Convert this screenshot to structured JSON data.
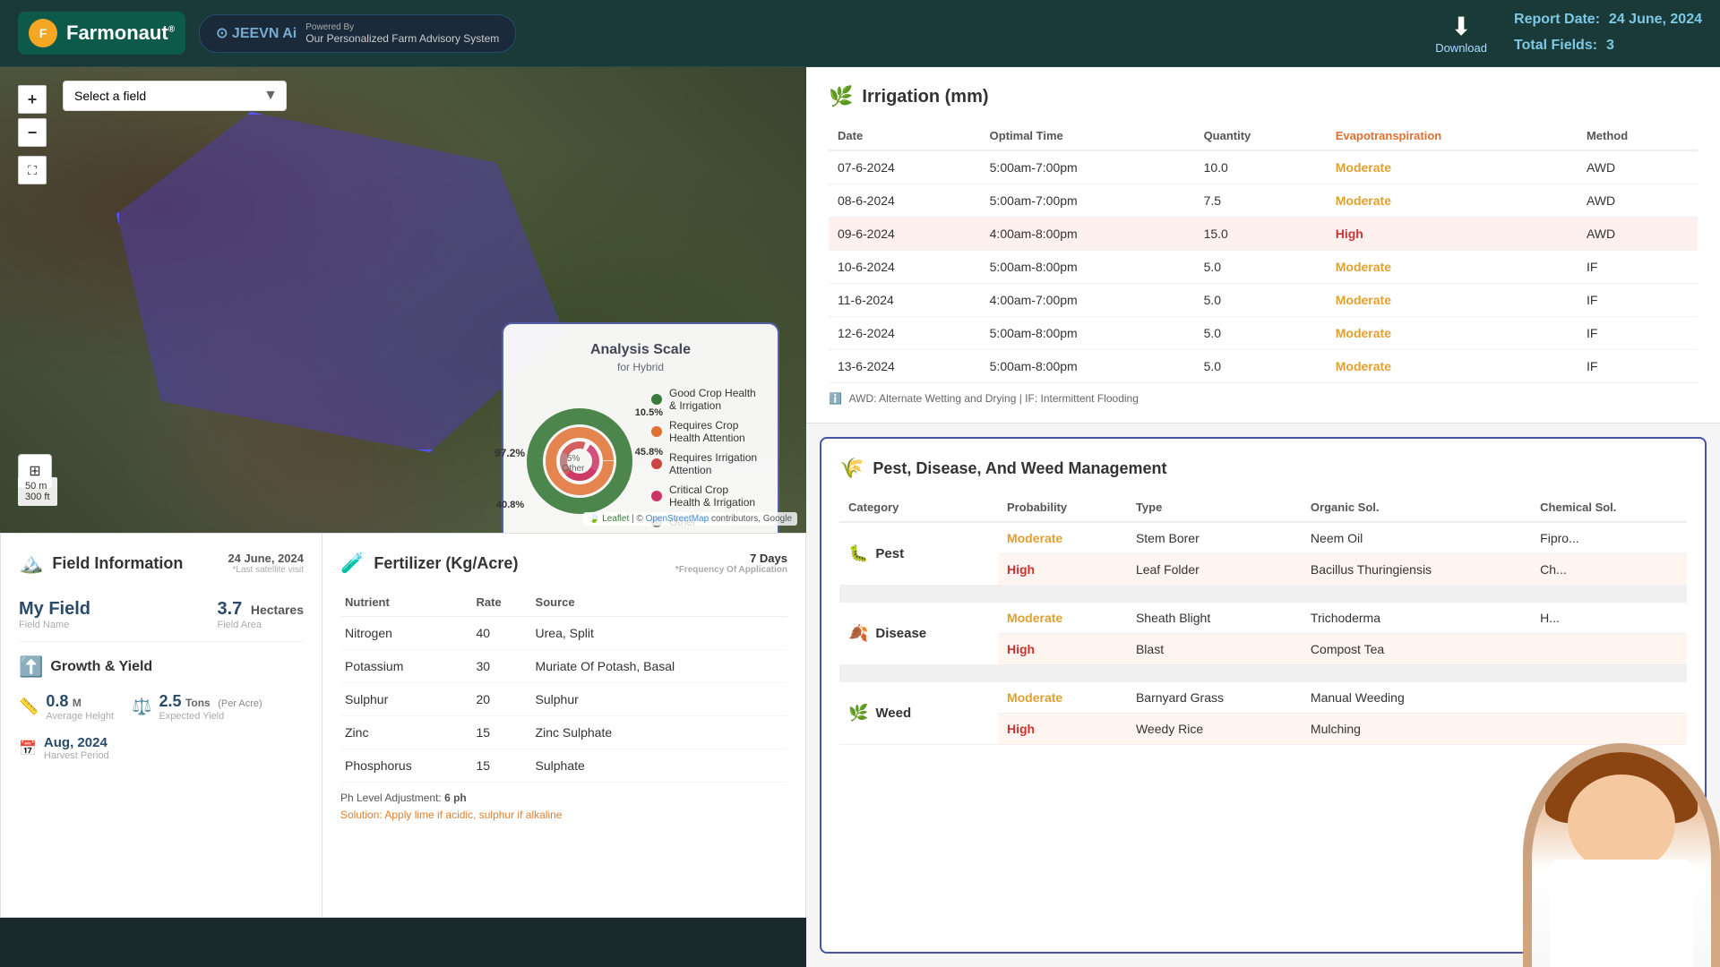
{
  "header": {
    "logo_text": "Farmonaut",
    "logo_reg": "®",
    "jeevn_text": "JEEVN Ai",
    "powered_by": "Powered By",
    "powered_desc": "Our Personalized Farm Advisory System",
    "download_label": "Download",
    "report_date_label": "Report Date:",
    "report_date": "24 June, 2024",
    "total_fields_label": "Total Fields:",
    "total_fields": "3"
  },
  "map": {
    "field_selector_placeholder": "Select a field",
    "zoom_in": "+",
    "zoom_out": "−",
    "scale_50m": "50 m",
    "scale_300ft": "300 ft",
    "attribution": "Leaflet | © OpenStreetMap contributors, Google"
  },
  "analysis_scale": {
    "title": "Analysis Scale",
    "subtitle": "for Hybrid",
    "segments": [
      {
        "label": "Good Crop Health & Irrigation",
        "pct": "97.2%",
        "color": "#3a7a3a"
      },
      {
        "label": "Requires Crop Health Attention",
        "pct": "10.5%",
        "color": "#e07030"
      },
      {
        "label": "Requires Irrigation Attention",
        "pct": "45.8%",
        "color": "#cc4444"
      },
      {
        "label": "Critical Crop Health & Irrigation",
        "pct": "40.8%",
        "color": "#cc3366"
      },
      {
        "label": "Other",
        "pct": "5%",
        "color": "#aaa",
        "inner": true
      }
    ]
  },
  "field_info": {
    "title": "Field Information",
    "date": "24 June, 2024",
    "last_satellite": "*Last satellite visit",
    "field_name": "My Field",
    "field_name_label": "Field Name",
    "field_area": "3.7 Hectares",
    "field_area_value": "3.7",
    "field_area_unit": "Hectares",
    "field_area_label": "Field Area"
  },
  "growth": {
    "title": "Growth & Yield",
    "avg_height": "0.8",
    "avg_height_unit": "M",
    "avg_height_label": "Average Height",
    "yield_val": "2.5",
    "yield_unit": "Tons",
    "yield_per": "(Per Acre)",
    "yield_label": "Expected Yield",
    "harvest_period": "Aug, 2024",
    "harvest_label": "Harvest Period"
  },
  "fertilizer": {
    "title": "Fertilizer (Kg/Acre)",
    "days": "7 Days",
    "frequency": "*Frequency Of Application",
    "columns": [
      "Nutrient",
      "Rate",
      "Source"
    ],
    "rows": [
      {
        "nutrient": "Nitrogen",
        "rate": "40",
        "source": "Urea, Split"
      },
      {
        "nutrient": "Potassium",
        "rate": "30",
        "source": "Muriate Of Potash, Basal"
      },
      {
        "nutrient": "Sulphur",
        "rate": "20",
        "source": "Sulphur"
      },
      {
        "nutrient": "Zinc",
        "rate": "15",
        "source": "Zinc Sulphate"
      },
      {
        "nutrient": "Phosphorus",
        "rate": "15",
        "source": "Sulphate"
      }
    ],
    "ph_note": "Ph Level Adjustment: 6 ph",
    "solution_note": "Solution: Apply lime if acidic, sulphur if alkaline"
  },
  "irrigation": {
    "title": "Irrigation (mm)",
    "columns": [
      "Date",
      "Optimal Time",
      "Quantity",
      "Evapotranspiration",
      "Method"
    ],
    "rows": [
      {
        "date": "07-6-2024",
        "time": "5:00am-7:00pm",
        "qty": "10.0",
        "et": "Moderate",
        "method": "AWD",
        "highlight": false
      },
      {
        "date": "08-6-2024",
        "time": "5:00am-7:00pm",
        "qty": "7.5",
        "et": "Moderate",
        "method": "AWD",
        "highlight": false
      },
      {
        "date": "09-6-2024",
        "time": "4:00am-8:00pm",
        "qty": "15.0",
        "et": "High",
        "method": "AWD",
        "highlight": true
      },
      {
        "date": "10-6-2024",
        "time": "5:00am-8:00pm",
        "qty": "5.0",
        "et": "Moderate",
        "method": "IF",
        "highlight": false
      },
      {
        "date": "11-6-2024",
        "time": "4:00am-7:00pm",
        "qty": "5.0",
        "et": "Moderate",
        "method": "IF",
        "highlight": false
      },
      {
        "date": "12-6-2024",
        "time": "5:00am-8:00pm",
        "qty": "5.0",
        "et": "Moderate",
        "method": "IF",
        "highlight": false
      },
      {
        "date": "13-6-2024",
        "time": "5:00am-8:00pm",
        "qty": "5.0",
        "et": "Moderate",
        "method": "IF",
        "highlight": false
      }
    ],
    "note": "AWD: Alternate Wetting and Drying | IF: Intermittent Flooding"
  },
  "pdw": {
    "title": "Pest, Disease, And Weed Management",
    "columns": [
      "Category",
      "Probability",
      "Type",
      "Organic Sol.",
      "Chemical Sol."
    ],
    "categories": [
      {
        "name": "Pest",
        "icon": "🐛",
        "rows": [
          {
            "prob": "Moderate",
            "type": "Stem Borer",
            "organic": "Neem Oil",
            "chemical": "Fipro..."
          },
          {
            "prob": "High",
            "type": "Leaf Folder",
            "organic": "Bacillus Thuringiensis",
            "chemical": "Ch..."
          }
        ]
      },
      {
        "name": "Disease",
        "icon": "🍂",
        "rows": [
          {
            "prob": "Moderate",
            "type": "Sheath Blight",
            "organic": "Trichoderma",
            "chemical": "H..."
          },
          {
            "prob": "High",
            "type": "Blast",
            "organic": "Compost Tea",
            "chemical": ""
          }
        ]
      },
      {
        "name": "Weed",
        "icon": "🌿",
        "rows": [
          {
            "prob": "Moderate",
            "type": "Barnyard Grass",
            "organic": "Manual Weeding",
            "chemical": ""
          },
          {
            "prob": "High",
            "type": "Weedy Rice",
            "organic": "Mulching",
            "chemical": ""
          }
        ]
      }
    ]
  }
}
